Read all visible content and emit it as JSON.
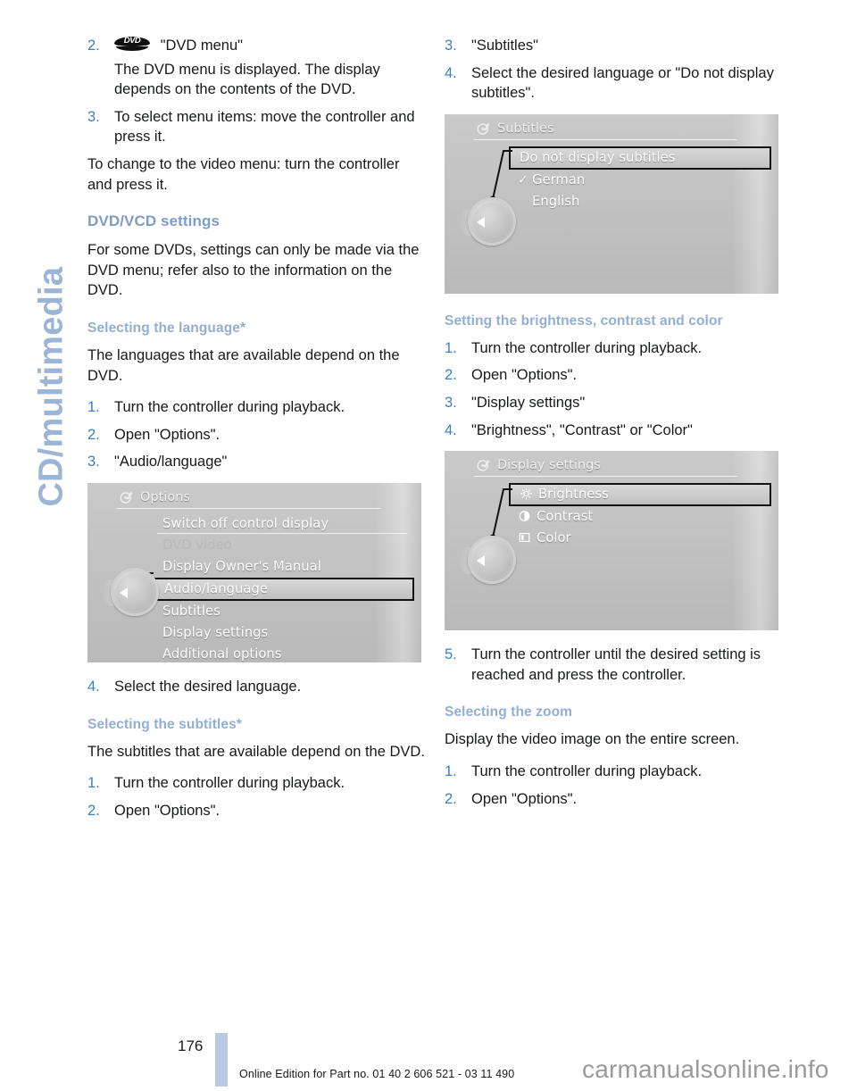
{
  "chapter_tab": {
    "label": "CD/multimedia"
  },
  "accent_colors": {
    "chapter_tab": "#9cb4d6",
    "section_heading": "#7e9cc8",
    "subsection_heading": "#93aed3",
    "step_number": "#3a7fc1",
    "footer_bar": "#b9c9e3"
  },
  "left_column": {
    "steps_top": [
      {
        "num": "2.",
        "icon": "dvd-logo-icon",
        "text": "\"DVD menu\"",
        "continuation": "The DVD menu is displayed. The display depends on the contents of the DVD."
      },
      {
        "num": "3.",
        "text": "To select menu items: move the controller and press it."
      }
    ],
    "paragraph_after_steps": "To change to the video menu: turn the controller and press it.",
    "section_heading": "DVD/VCD settings",
    "section_body": "For some DVDs, settings can only be made via the DVD menu; refer also to the information on the DVD.",
    "subsection_language": {
      "heading": "Selecting the language*",
      "body": "The languages that are available depend on the DVD.",
      "steps": [
        {
          "num": "1.",
          "text": "Turn the controller during playback."
        },
        {
          "num": "2.",
          "text": "Open \"Options\"."
        },
        {
          "num": "3.",
          "text": "\"Audio/language\""
        }
      ],
      "step_after_image": {
        "num": "4.",
        "text": "Select the desired language."
      }
    },
    "subsection_subtitles": {
      "heading": "Selecting the subtitles*",
      "body": "The subtitles that are available depend on the DVD.",
      "steps": [
        {
          "num": "1.",
          "text": "Turn the controller during playback."
        },
        {
          "num": "2.",
          "text": "Open \"Options\"."
        }
      ]
    }
  },
  "right_column": {
    "steps_top": [
      {
        "num": "3.",
        "text": "\"Subtitles\""
      },
      {
        "num": "4.",
        "text": "Select the desired language or \"Do not display subtitles\"."
      }
    ],
    "subsection_brightness": {
      "heading": "Setting the brightness, contrast and color",
      "steps": [
        {
          "num": "1.",
          "text": "Turn the controller during playback."
        },
        {
          "num": "2.",
          "text": "Open \"Options\"."
        },
        {
          "num": "3.",
          "text": "\"Display settings\""
        },
        {
          "num": "4.",
          "text": "\"Brightness\", \"Contrast\" or \"Color\""
        }
      ],
      "step_after_image": {
        "num": "5.",
        "text": "Turn the controller until the desired setting is reached and press the controller."
      }
    },
    "subsection_zoom": {
      "heading": "Selecting the zoom",
      "body": "Display the video image on the entire screen.",
      "steps": [
        {
          "num": "1.",
          "text": "Turn the controller during playback."
        },
        {
          "num": "2.",
          "text": "Open \"Options\"."
        }
      ]
    }
  },
  "screenshots": {
    "options": {
      "header_icon": "cd-note-icon",
      "title": "Options",
      "items": [
        {
          "label": "Switch off control display",
          "state": "underlined"
        },
        {
          "label": "DVD video",
          "state": "dim"
        },
        {
          "label": "Display Owner's Manual",
          "state": "normal"
        },
        {
          "label": "Audio/language",
          "state": "selected"
        },
        {
          "label": "Subtitles",
          "state": "normal"
        },
        {
          "label": "Display settings",
          "state": "normal"
        },
        {
          "label": "Additional options",
          "state": "normal"
        }
      ]
    },
    "subtitles": {
      "header_icon": "cd-note-icon",
      "title": "Subtitles",
      "items": [
        {
          "label": "Do not display subtitles",
          "state": "selected"
        },
        {
          "label": "German",
          "state": "checked"
        },
        {
          "label": "English",
          "state": "normal"
        }
      ]
    },
    "display_settings": {
      "header_icon": "cd-note-icon",
      "title": "Display settings",
      "items": [
        {
          "label": "Brightness",
          "state": "selected",
          "icon": "sun-icon"
        },
        {
          "label": "Contrast",
          "state": "normal",
          "icon": "contrast-icon"
        },
        {
          "label": "Color",
          "state": "normal",
          "icon": "color-icon"
        }
      ]
    }
  },
  "footer": {
    "page_number": "176",
    "edition": "Online Edition for Part no. 01 40 2 606 521 - 03 11 490",
    "watermark": "carmanualsonline.info"
  }
}
